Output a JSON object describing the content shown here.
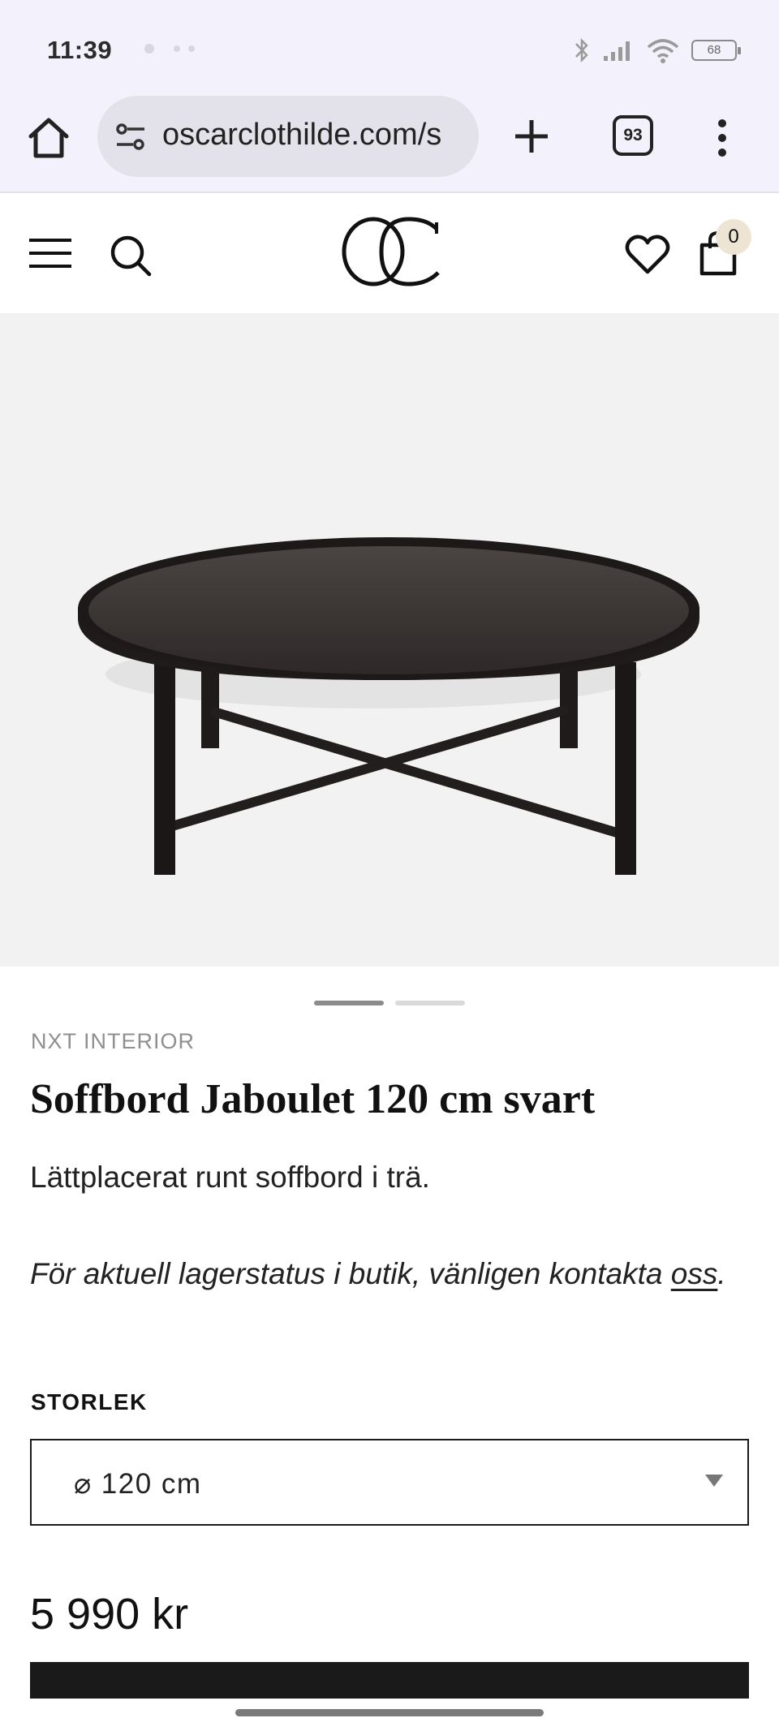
{
  "status_bar": {
    "time": "11:39",
    "battery": "68"
  },
  "browser": {
    "url": "oscarclothilde.com/s",
    "tab_count": "93"
  },
  "header": {
    "logo_text": "OC",
    "cart_count": "0"
  },
  "product": {
    "brand": "NXT INTERIOR",
    "title": "Soffbord Jaboulet 120 cm svart",
    "description": "Lättplacerat runt soffbord i trä.",
    "stock_text": "För aktuell lagerstatus i butik, vänligen kontakta ",
    "stock_link": "oss",
    "stock_end": ".",
    "size_label": "STORLEK",
    "size_selected": "⌀ 120 cm",
    "price": "5 990 kr"
  },
  "carousel": {
    "total": 2,
    "active": 1
  },
  "colors": {
    "browser_bg": "#f3f1fb",
    "url_pill": "#e3e2ea",
    "image_bg": "#f2f2f2",
    "cart_badge": "#ede4d3",
    "table": "#1f1b1a"
  },
  "icons": {
    "browser": [
      "home-icon",
      "site-settings-icon",
      "new-tab-icon",
      "tab-switcher-icon",
      "more-menu-icon"
    ],
    "header": [
      "menu-icon",
      "search-icon",
      "heart-icon",
      "shopping-bag-icon"
    ]
  }
}
